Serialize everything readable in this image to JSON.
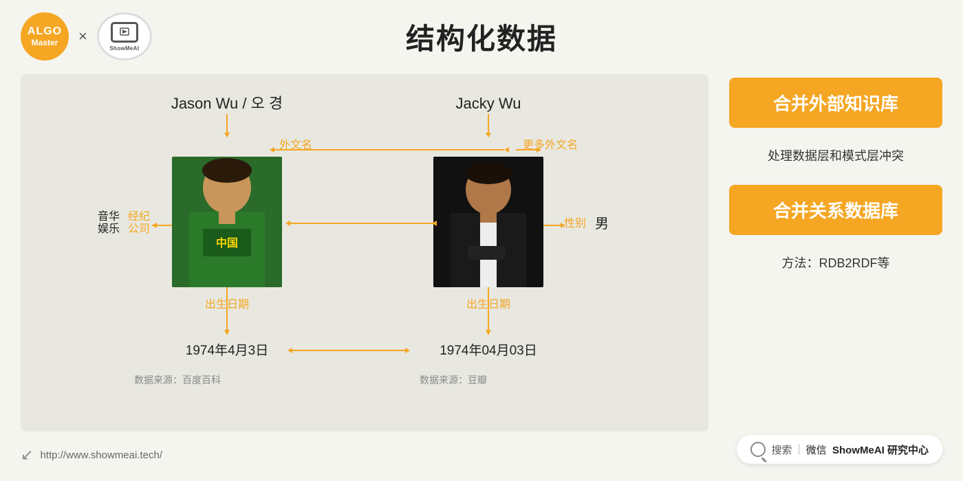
{
  "page": {
    "title": "结构化数据",
    "background_color": "#f5f5f0"
  },
  "header": {
    "algo_label_1": "ALGO",
    "algo_label_2": "Master",
    "x_separator": "×",
    "showme_label": "Show Me AI"
  },
  "diagram": {
    "person1": {
      "name": "Jason Wu / 오 경",
      "attr_foreign_name": "外文名",
      "attr_agency": "经纪\n公司",
      "attr_agency_full": "音华\n娱乐",
      "attr_birthday": "出生日期",
      "birthday_value": "1974年4月3日",
      "data_source": "数据来源：百度百科"
    },
    "person2": {
      "name": "Jacky Wu",
      "attr_foreign_name": "更多外文名",
      "attr_gender": "性别",
      "attr_gender_value": "男",
      "attr_birthday": "出生日期",
      "birthday_value": "1974年04月03日",
      "data_source": "数据来源：豆瓣"
    },
    "arrow_label_foreign": "外文名",
    "arrow_label_bidirectional": "↔"
  },
  "panels": {
    "panel1": {
      "title": "合并外部知识库",
      "description": "处理数据层和模式层冲突"
    },
    "panel2": {
      "title": "合并关系数据库",
      "description": "方法：RDB2RDF等"
    }
  },
  "search_bar": {
    "icon_label": "搜索",
    "divider": "|",
    "platform": "微信",
    "brand": "ShowMeAI 研究中心"
  },
  "footer": {
    "url": "http://www.showmeai.tech/"
  }
}
